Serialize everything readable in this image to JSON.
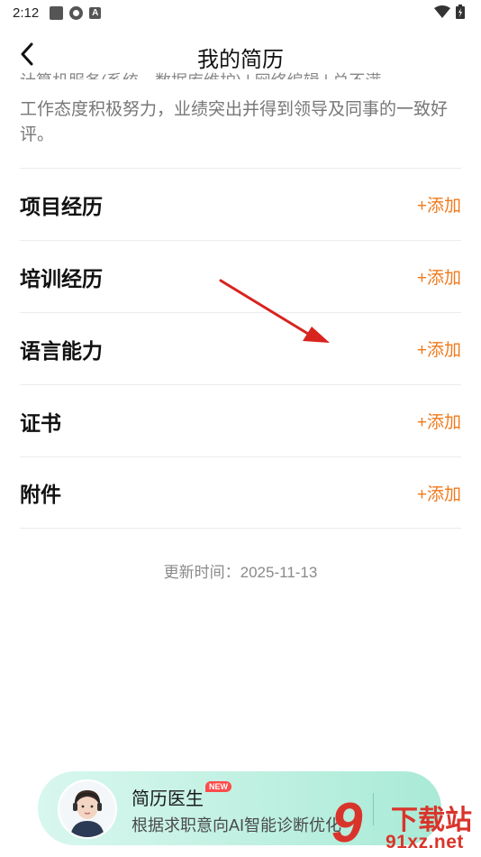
{
  "status_bar": {
    "time": "2:12"
  },
  "nav": {
    "title": "我的简历"
  },
  "prev_section": {
    "clipped_line": "计算机服务(系统、数据库维护) | 网络编辑 | 兑不满",
    "description": "工作态度积极努力，业绩突出并得到领导及同事的一致好评。"
  },
  "sections": [
    {
      "title": "项目经历",
      "action": "+添加"
    },
    {
      "title": "培训经历",
      "action": "+添加"
    },
    {
      "title": "语言能力",
      "action": "+添加"
    },
    {
      "title": "证书",
      "action": "+添加"
    },
    {
      "title": "附件",
      "action": "+添加"
    }
  ],
  "update_time": "更新时间：2025-11-13",
  "banner": {
    "title": "简历医生",
    "badge": "NEW",
    "subtitle": "根据求职意向AI智能诊断优化"
  },
  "watermark": {
    "nine": "9",
    "text": "下载站",
    "url": "91xz.net"
  },
  "colors": {
    "accent": "#f07a1d",
    "arrow": "#d9231f",
    "banner": "#bff0e1"
  }
}
